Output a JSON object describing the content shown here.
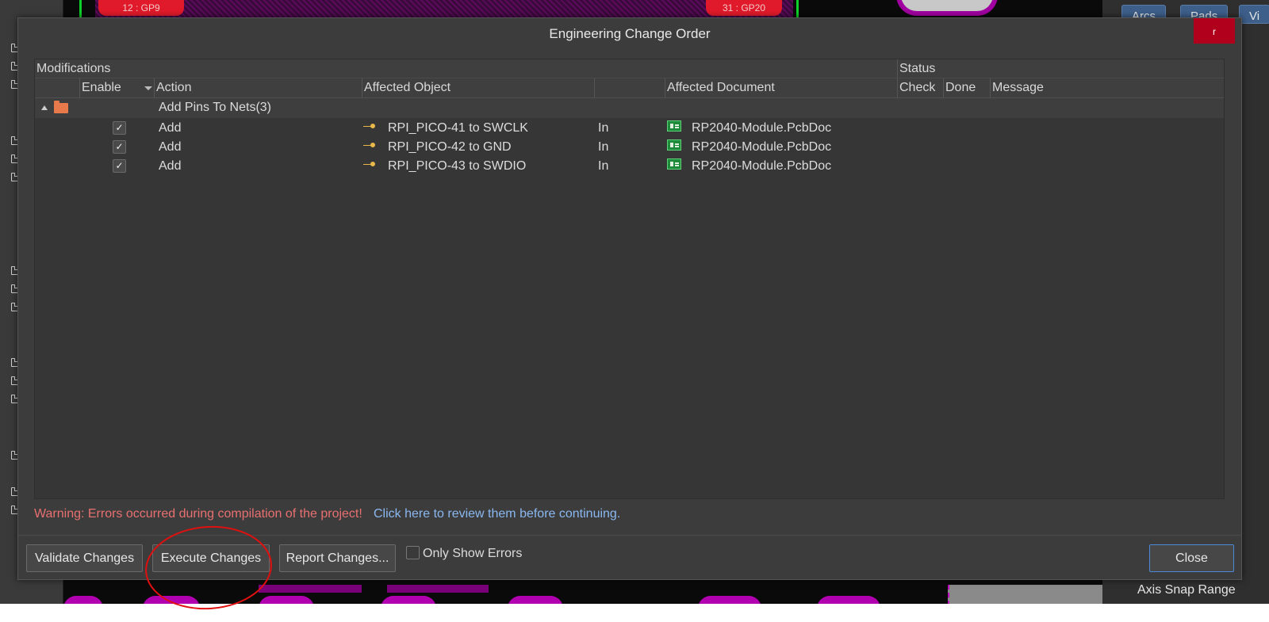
{
  "background": {
    "pcb_pads": [
      "12 : GP9",
      "31 : GP20"
    ],
    "right_panel_buttons": [
      "Arcs",
      "Pads",
      "Vi"
    ],
    "axis_snap_label": "Axis Snap Range"
  },
  "dialog": {
    "title": "Engineering Change Order",
    "close_x_label": "r",
    "group_headers": {
      "modifications": "Modifications",
      "status": "Status"
    },
    "columns": {
      "enable": "Enable",
      "action": "Action",
      "affected_object": "Affected Object",
      "affected_document": "Affected Document",
      "check": "Check",
      "done": "Done",
      "message": "Message"
    },
    "group_row": {
      "label": "Add Pins To Nets(3)"
    },
    "rows": [
      {
        "enabled": true,
        "action": "Add",
        "object": "RPI_PICO-41 to SWCLK",
        "direction": "In",
        "document": "RP2040-Module.PcbDoc",
        "check": "",
        "done": "",
        "message": ""
      },
      {
        "enabled": true,
        "action": "Add",
        "object": "RPI_PICO-42 to GND",
        "direction": "In",
        "document": "RP2040-Module.PcbDoc",
        "check": "",
        "done": "",
        "message": ""
      },
      {
        "enabled": true,
        "action": "Add",
        "object": "RPI_PICO-43 to SWDIO",
        "direction": "In",
        "document": "RP2040-Module.PcbDoc",
        "check": "",
        "done": "",
        "message": ""
      }
    ],
    "warning_text": "Warning: Errors occurred during compilation of the project!",
    "review_link": "Click here to review them before continuing.",
    "buttons": {
      "validate": "Validate Changes",
      "execute": "Execute Changes",
      "report": "Report Changes...",
      "only_show_errors": "Only Show Errors",
      "close": "Close"
    },
    "only_show_errors_checked": false
  },
  "colors": {
    "dialog_bg": "#3c3c3c",
    "warning": "#e87070",
    "link": "#8ab8f0",
    "accent_close": "#4a8ad8",
    "title_close_red": "#b0001c",
    "annotation": "#e01010"
  }
}
